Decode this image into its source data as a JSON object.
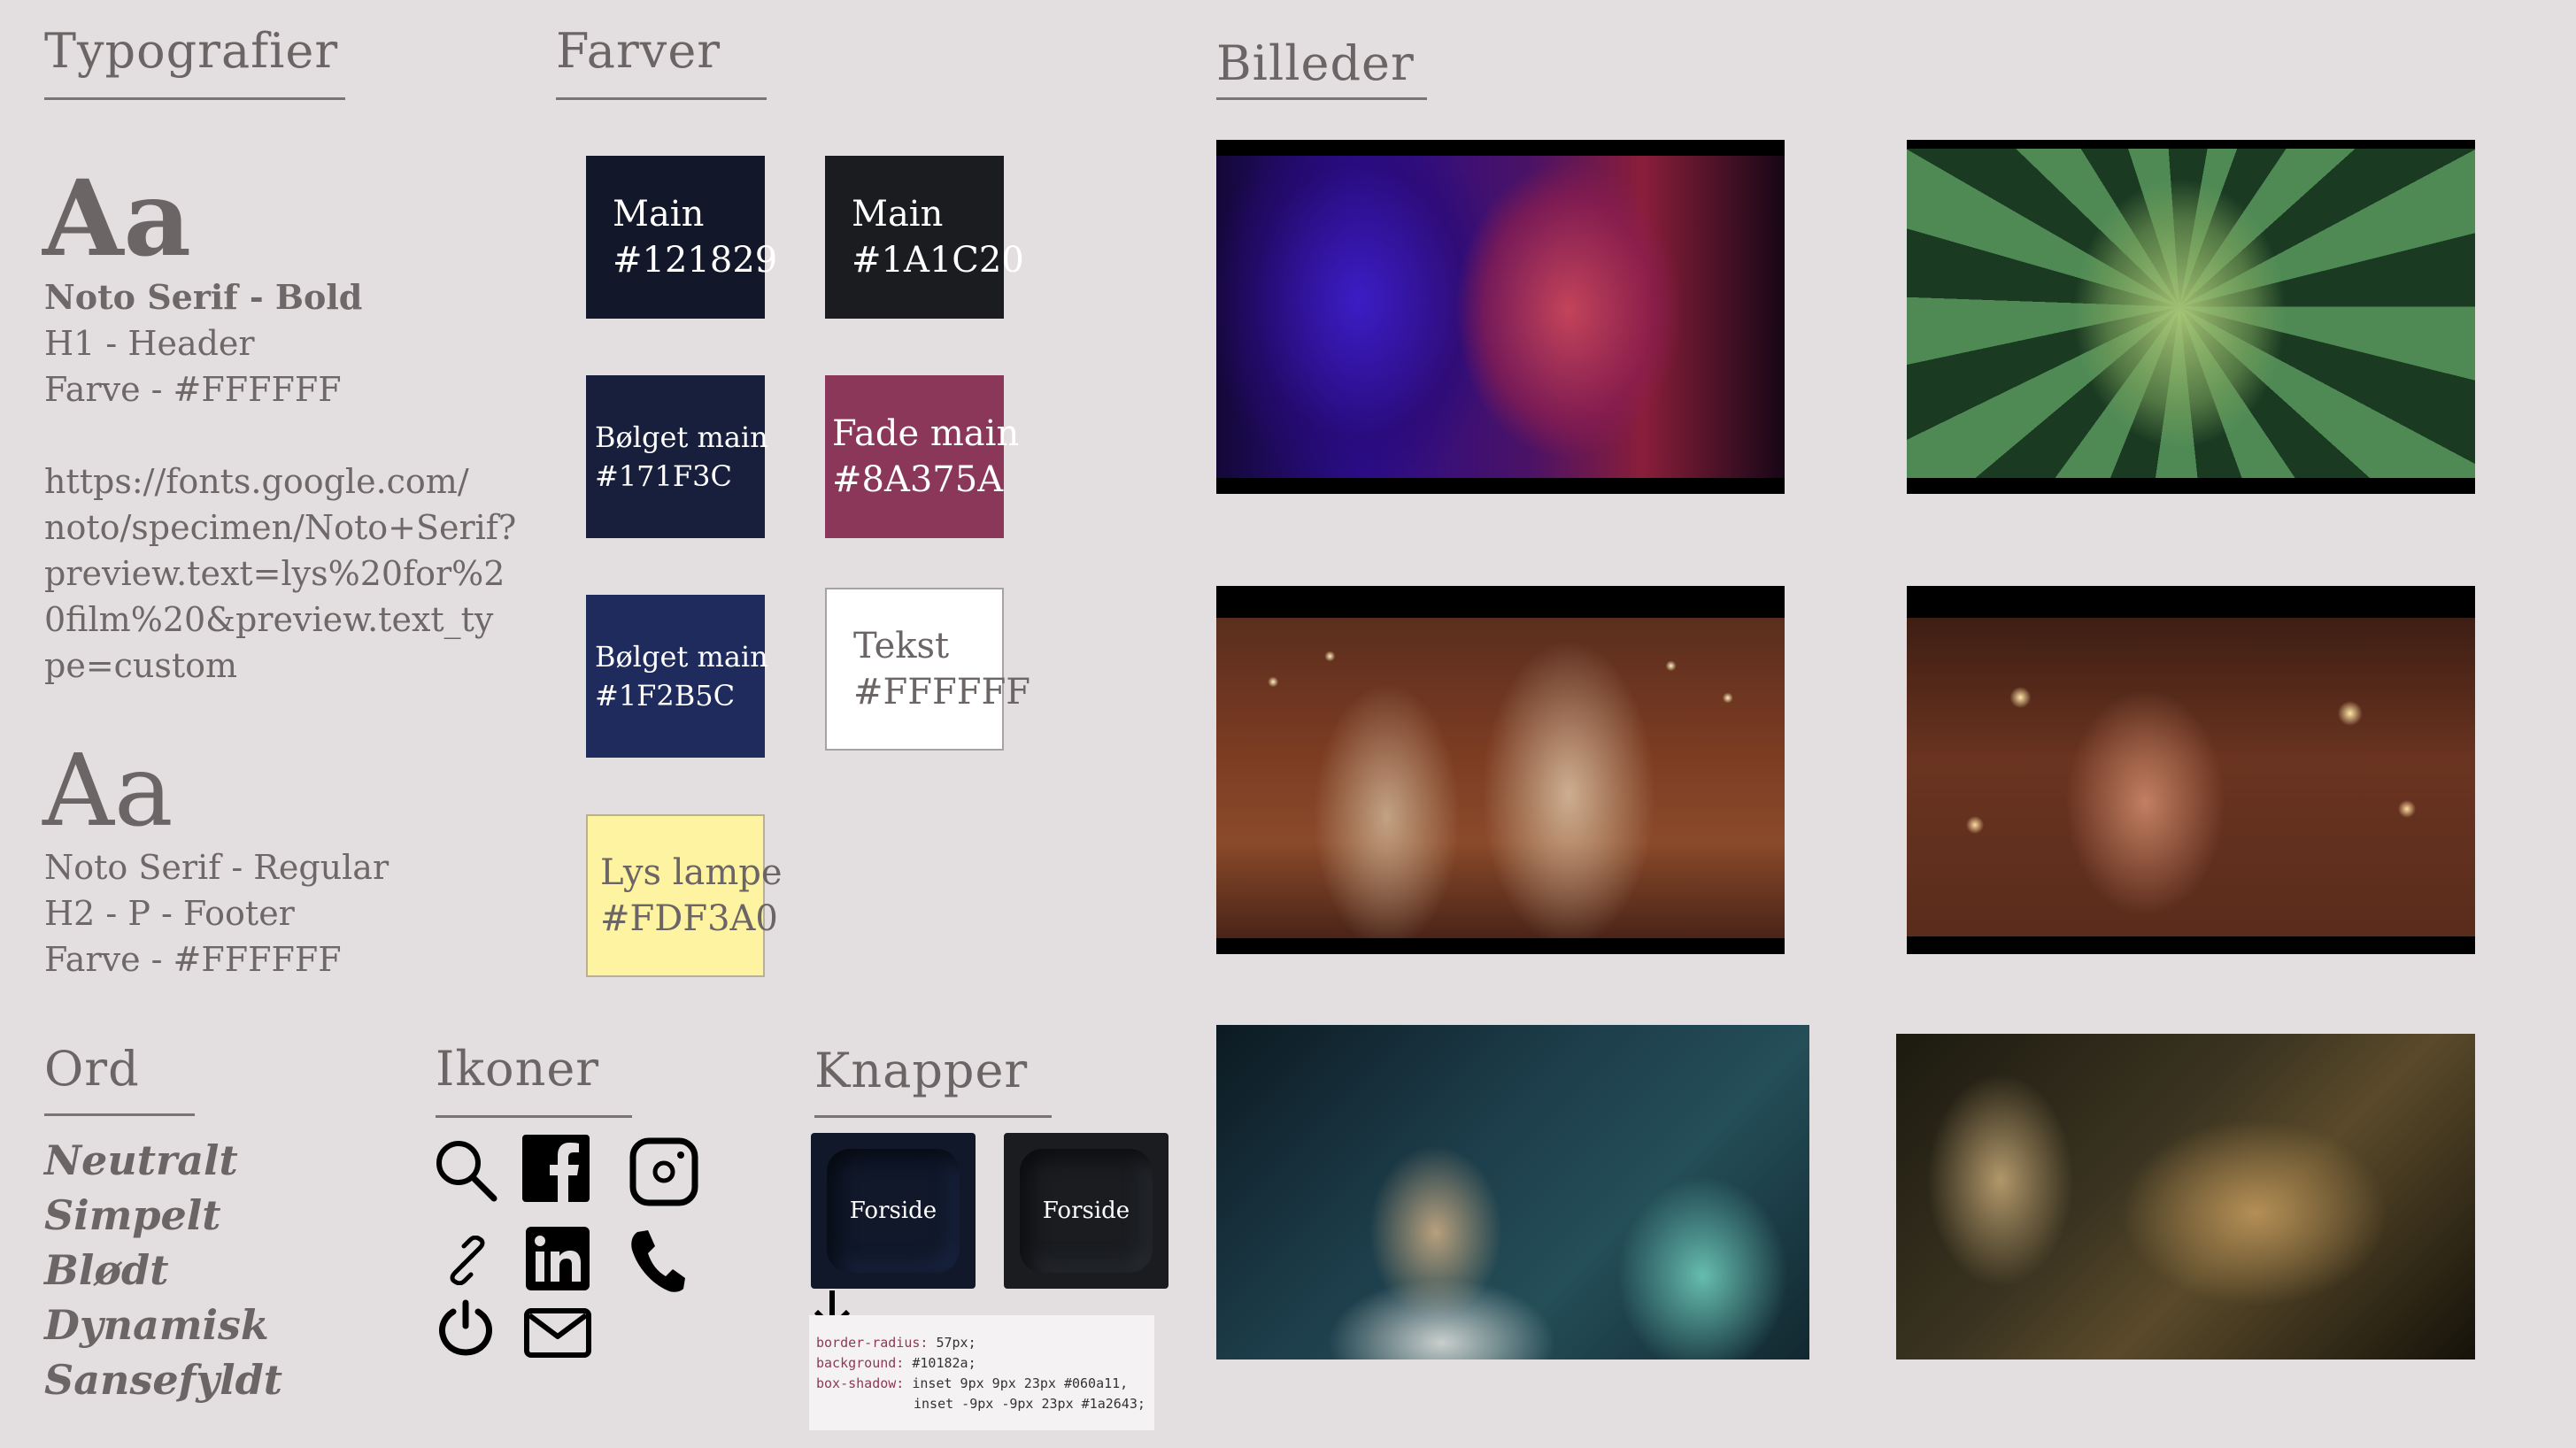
{
  "sections": {
    "typografier": "Typografier",
    "farver": "Farver",
    "billeder": "Billeder",
    "ord": "Ord",
    "ikoner": "Ikoner",
    "knapper": "Knapper"
  },
  "typography": {
    "sample": "Aa",
    "bold": {
      "name": "Noto Serif - Bold",
      "usage": "H1 - Header",
      "color": "Farve -  #FFFFFF",
      "url_lines": [
        "https://fonts.google.com/",
        "noto/specimen/Noto+Serif?",
        "preview.text=lys%20for%2",
        "0film%20&preview.text_ty",
        "pe=custom"
      ]
    },
    "regular": {
      "name": "Noto Serif - Regular",
      "usage": "H2 - P - Footer",
      "color": "Farve - #FFFFFF"
    }
  },
  "colors": [
    {
      "label": "Main",
      "hex": "#121829",
      "bg": "#121829",
      "fg": "#ffffff"
    },
    {
      "label": "Main",
      "hex": "#1A1C20",
      "bg": "#1a1c20",
      "fg": "#ffffff"
    },
    {
      "label": "Bølget main",
      "hex": "#171F3C",
      "bg": "#171f3c",
      "fg": "#ffffff"
    },
    {
      "label": "Fade main",
      "hex": "#8A375A",
      "bg": "#8a375a",
      "fg": "#ffffff"
    },
    {
      "label": "Bølget main",
      "hex": "#1F2B5C",
      "bg": "#1f2b5c",
      "fg": "#ffffff"
    },
    {
      "label": "Tekst",
      "hex": "#FFFFFF",
      "bg": "#ffffff",
      "fg": "#6b6565"
    },
    {
      "label": "Lys lampe",
      "hex": "#FDF3A0",
      "bg": "#fdf3a0",
      "fg": "#6b6565"
    }
  ],
  "words": [
    "Neutralt",
    "Simpelt",
    "Blødt",
    "Dynamisk",
    "Sansefyldt"
  ],
  "icons": [
    "search-icon",
    "facebook-icon",
    "instagram-icon",
    "link-icon",
    "linkedin-icon",
    "phone-icon",
    "power-icon",
    "mail-icon"
  ],
  "buttons": {
    "label_1": "Forside",
    "label_2": "Forside",
    "code": {
      "l1_prop": "border-radius:",
      "l1_val": " 57px;",
      "l2_prop": "background:",
      "l2_val": " #10182a;",
      "l3_prop": "box-shadow:",
      "l3_val": " inset 9px 9px 23px #060a11,",
      "l4_val": "inset -9px -9px 23px #1a2643;"
    }
  },
  "images": [
    "woman-purple-red-light-photo",
    "woman-green-spiral-photo",
    "two-women-string-lights-photo",
    "woman-bokeh-lights-photo",
    "man-reaching-blue-room-photo",
    "man-looking-at-object-photo"
  ]
}
